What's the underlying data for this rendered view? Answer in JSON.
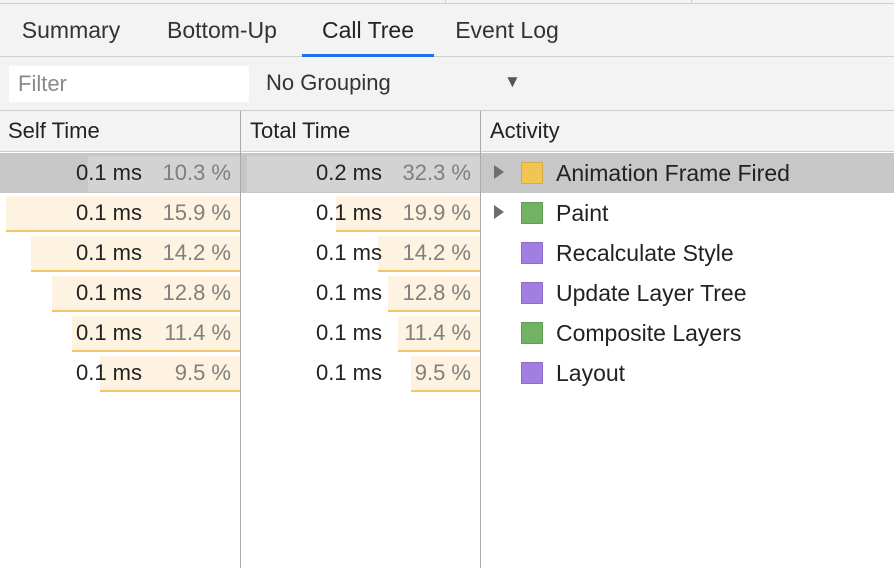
{
  "tabs": [
    {
      "label": "Summary",
      "active": false
    },
    {
      "label": "Bottom-Up",
      "active": false
    },
    {
      "label": "Call Tree",
      "active": true
    },
    {
      "label": "Event Log",
      "active": false
    }
  ],
  "filter": {
    "placeholder": "Filter",
    "value": ""
  },
  "grouping": {
    "selected": "No Grouping",
    "arrow_icon": "triangle-down-icon"
  },
  "columns": {
    "self_time": "Self Time",
    "total_time": "Total Time",
    "activity": "Activity"
  },
  "colors": {
    "tab_accent": "#1a73e8",
    "bar_fill": "#fdf3e0",
    "bar_line": "#f5c469",
    "selected_row": "#c7c7c7",
    "scripting": "#f2c553",
    "painting": "#71b363",
    "rendering": "#a07ee2"
  },
  "rows": [
    {
      "self_time": "0.1 ms",
      "self_percent": "10.3 %",
      "self_fraction": 0.103,
      "total_time": "0.2 ms",
      "total_percent": "32.3 %",
      "total_fraction": 0.323,
      "activity": "Animation Frame Fired",
      "category_color": "#f2c553",
      "expandable": true,
      "selected": true
    },
    {
      "self_time": "0.1 ms",
      "self_percent": "15.9 %",
      "self_fraction": 0.159,
      "total_time": "0.1 ms",
      "total_percent": "19.9 %",
      "total_fraction": 0.199,
      "activity": "Paint",
      "category_color": "#71b363",
      "expandable": true,
      "selected": false
    },
    {
      "self_time": "0.1 ms",
      "self_percent": "14.2 %",
      "self_fraction": 0.142,
      "total_time": "0.1 ms",
      "total_percent": "14.2 %",
      "total_fraction": 0.142,
      "activity": "Recalculate Style",
      "category_color": "#a07ee2",
      "expandable": false,
      "selected": false
    },
    {
      "self_time": "0.1 ms",
      "self_percent": "12.8 %",
      "self_fraction": 0.128,
      "total_time": "0.1 ms",
      "total_percent": "12.8 %",
      "total_fraction": 0.128,
      "activity": "Update Layer Tree",
      "category_color": "#a07ee2",
      "expandable": false,
      "selected": false
    },
    {
      "self_time": "0.1 ms",
      "self_percent": "11.4 %",
      "self_fraction": 0.114,
      "total_time": "0.1 ms",
      "total_percent": "11.4 %",
      "total_fraction": 0.114,
      "activity": "Composite Layers",
      "category_color": "#71b363",
      "expandable": false,
      "selected": false
    },
    {
      "self_time": "0.1 ms",
      "self_percent": "9.5 %",
      "self_fraction": 0.095,
      "total_time": "0.1 ms",
      "total_percent": "9.5 %",
      "total_fraction": 0.095,
      "activity": "Layout",
      "category_color": "#a07ee2",
      "expandable": false,
      "selected": false
    }
  ]
}
